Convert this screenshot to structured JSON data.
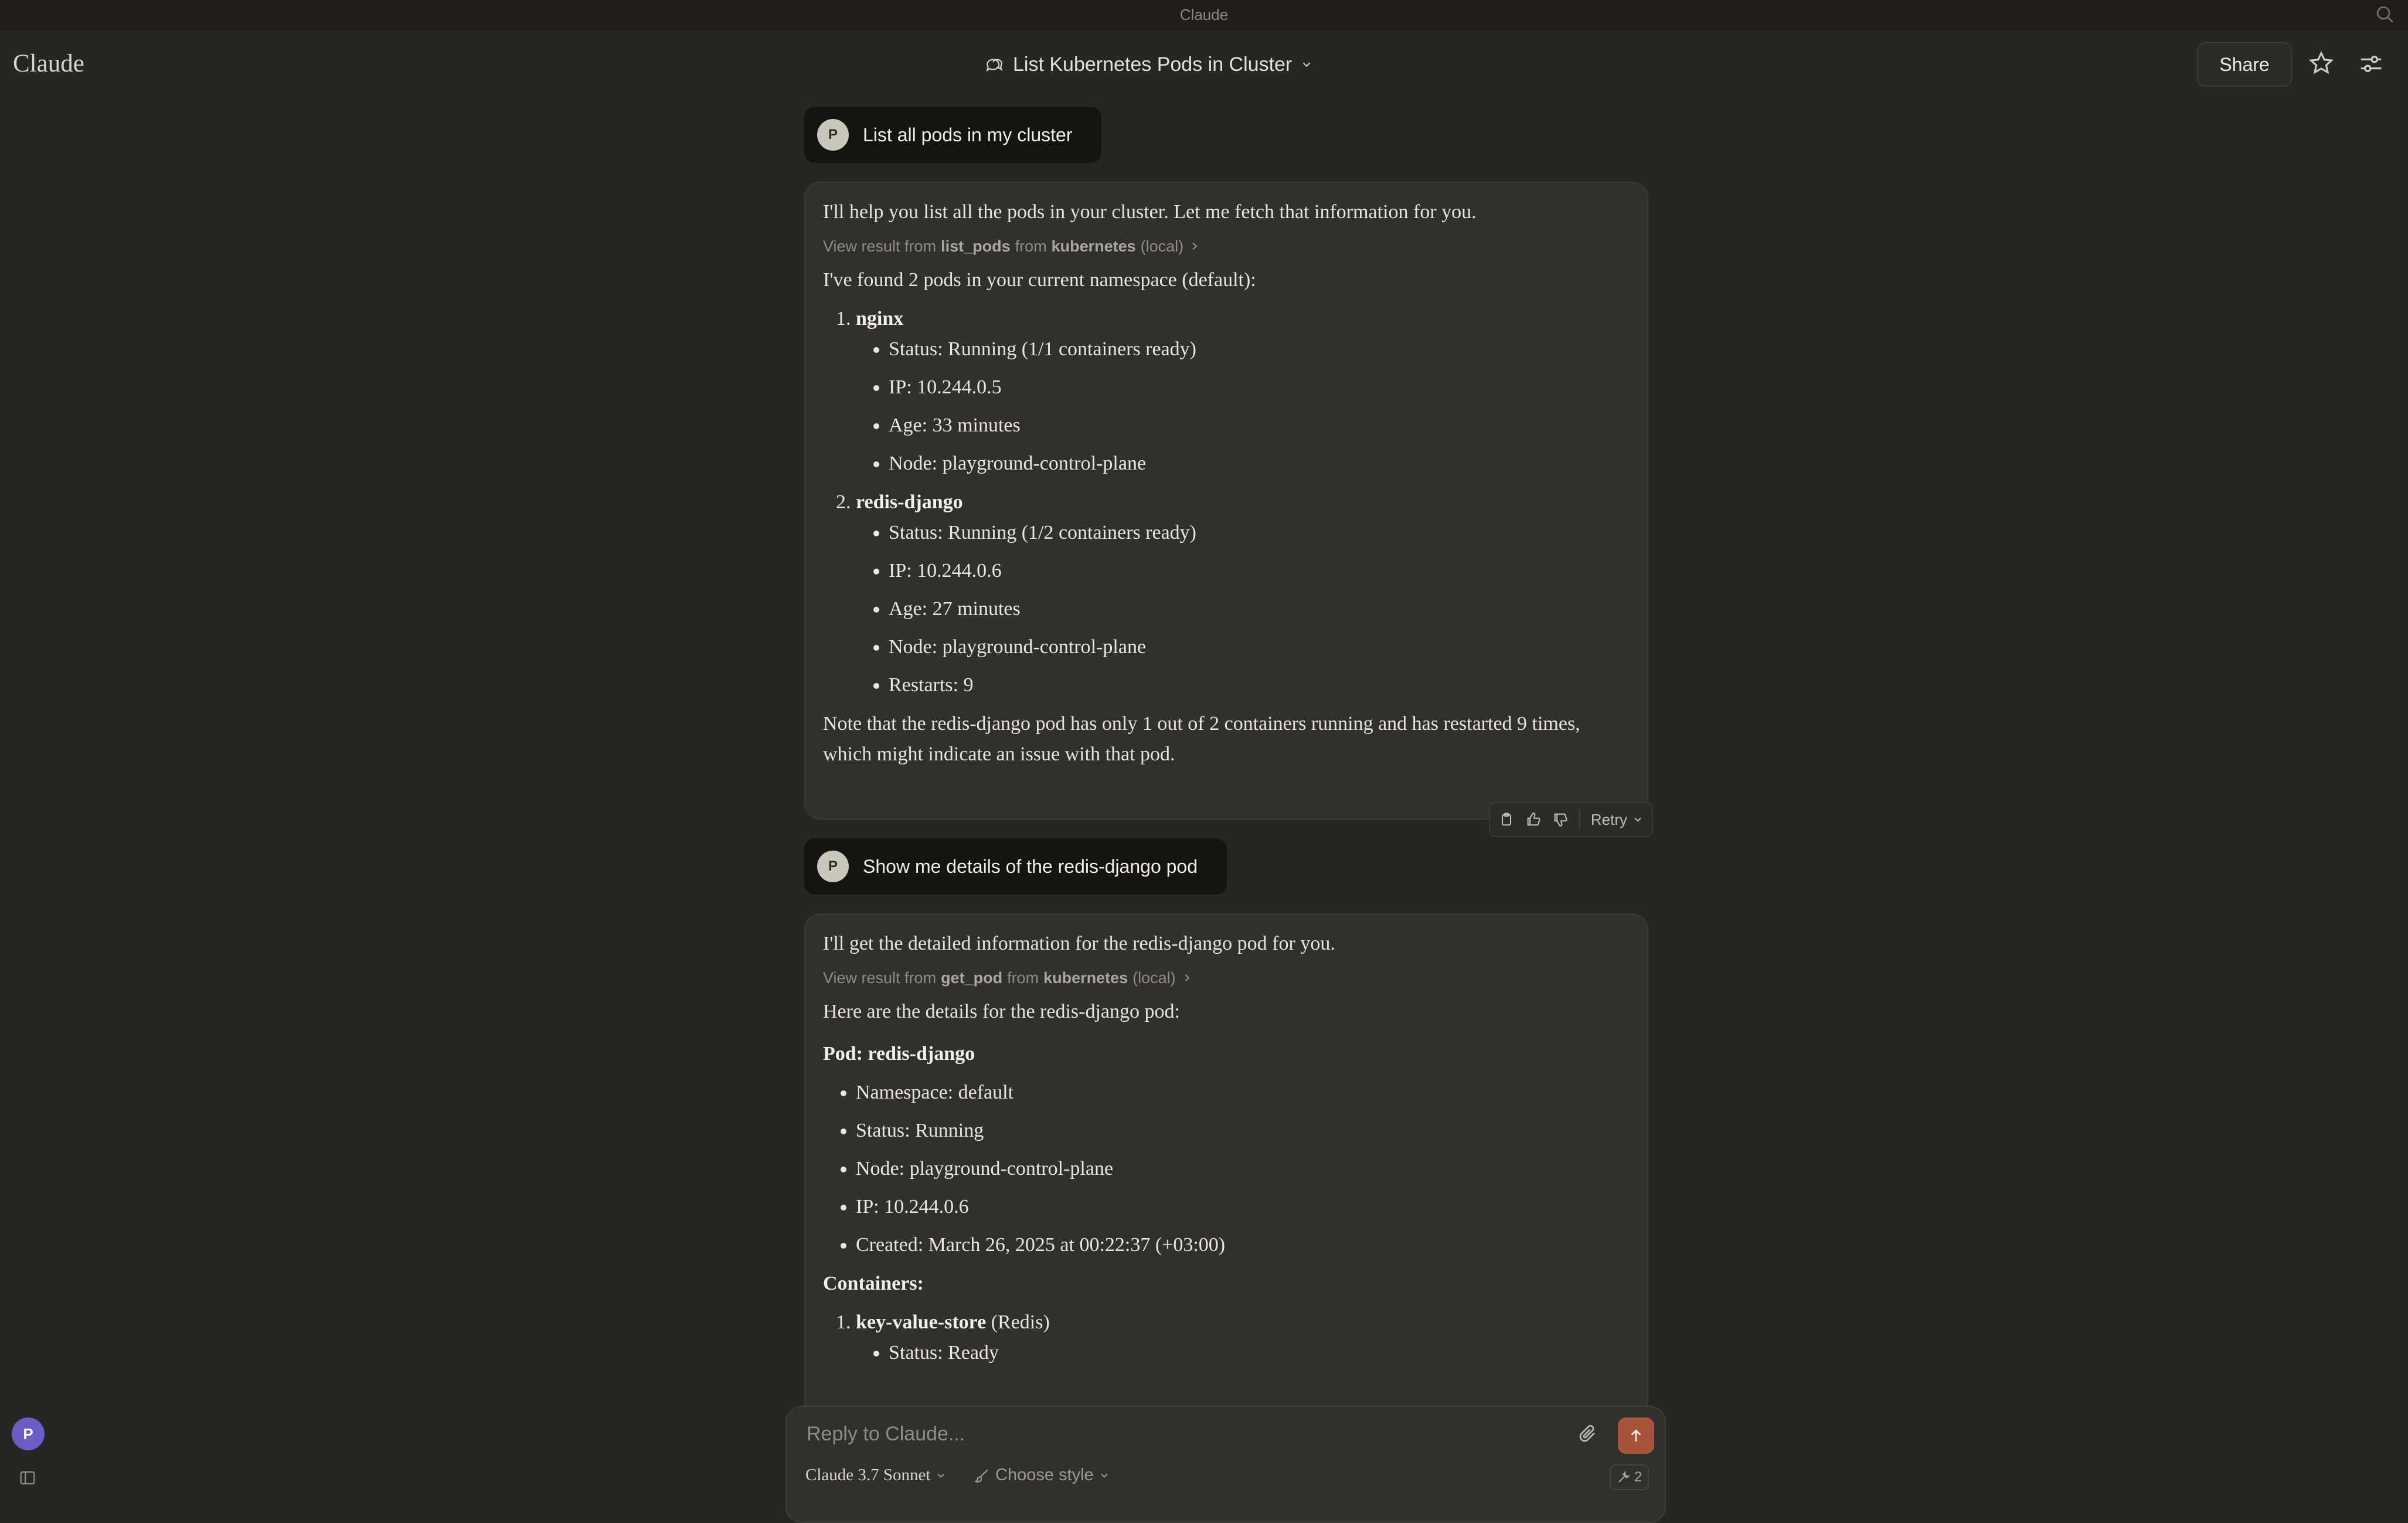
{
  "window": {
    "title": "Claude"
  },
  "header": {
    "brand": "Claude",
    "conversation_title": "List Kubernetes Pods in Cluster",
    "share_label": "Share"
  },
  "messages": {
    "user1": {
      "avatar": "P",
      "text": "List all pods in my cluster"
    },
    "a1": {
      "intro": "I'll help you list all the pods in your cluster. Let me fetch that information for you.",
      "tool": {
        "prefix": "View result from",
        "name": "list_pods",
        "from": "from",
        "server": "kubernetes",
        "scope": "(local)"
      },
      "summary": "I've found 2 pods in your current namespace (default):",
      "pods": [
        {
          "name": "nginx",
          "details": [
            "Status: Running (1/1 containers ready)",
            "IP: 10.244.0.5",
            "Age: 33 minutes",
            "Node: playground-control-plane"
          ]
        },
        {
          "name": "redis-django",
          "details": [
            "Status: Running (1/2 containers ready)",
            "IP: 10.244.0.6",
            "Age: 27 minutes",
            "Node: playground-control-plane",
            "Restarts: 9"
          ]
        }
      ],
      "note": "Note that the redis-django pod has only 1 out of 2 containers running and has restarted 9 times, which might indicate an issue with that pod.",
      "actions": {
        "retry_label": "Retry"
      }
    },
    "user2": {
      "avatar": "P",
      "text": "Show me details of the redis-django pod"
    },
    "a2": {
      "intro": "I'll get the detailed information for the redis-django pod for you.",
      "tool": {
        "prefix": "View result from",
        "name": "get_pod",
        "from": "from",
        "server": "kubernetes",
        "scope": "(local)"
      },
      "summary": "Here are the details for the redis-django pod:",
      "pod_heading": "Pod: redis-django",
      "details": [
        "Namespace: default",
        "Status: Running",
        "Node: playground-control-plane",
        "IP: 10.244.0.6",
        "Created: March 26, 2025 at 00:22:37 (+03:00)"
      ],
      "containers_heading": "Containers:",
      "containers": [
        {
          "name": "key-value-store",
          "suffix": " (Redis)",
          "details": [
            "Status: Ready"
          ]
        }
      ]
    }
  },
  "composer": {
    "placeholder": "Reply to Claude...",
    "model": "Claude 3.7 Sonnet",
    "style": "Choose style",
    "tools_count": "2"
  },
  "sidebar": {
    "user_avatar": "P"
  },
  "colors": {
    "accent": "#a8543b",
    "background": "#262624",
    "card": "#30302e",
    "user_bubble": "#141413",
    "user_avatar": "#6b5cc6"
  },
  "icons": [
    "search-icon",
    "chat-bubbles-icon",
    "chevron-down-icon",
    "star-icon",
    "settings-sliders-icon",
    "chevron-right-icon",
    "copy-icon",
    "thumbs-up-icon",
    "thumbs-down-icon",
    "paperclip-icon",
    "arrow-up-icon",
    "brush-icon",
    "tools-icon",
    "sidebar-toggle-icon"
  ]
}
